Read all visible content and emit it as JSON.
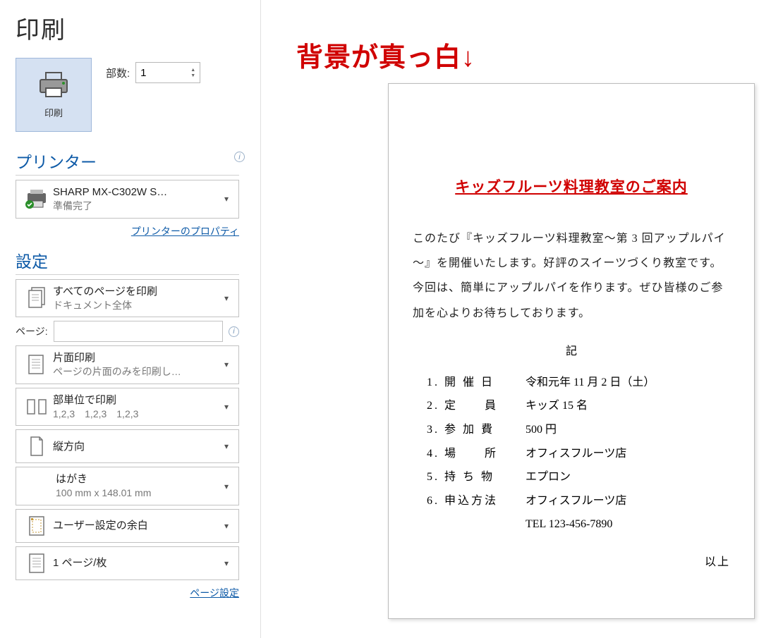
{
  "title": "印刷",
  "print_button_label": "印刷",
  "copies": {
    "label": "部数:",
    "value": "1"
  },
  "printer_section": {
    "heading": "プリンター",
    "name": "SHARP MX-C302W S…",
    "status": "準備完了",
    "properties_link": "プリンターのプロパティ"
  },
  "settings_section": {
    "heading": "設定",
    "print_range": {
      "line1": "すべてのページを印刷",
      "line2": "ドキュメント全体"
    },
    "pages_label": "ページ:",
    "duplex": {
      "line1": "片面印刷",
      "line2": "ページの片面のみを印刷し…"
    },
    "collation": {
      "line1": "部単位で印刷",
      "line2": "1,2,3　1,2,3　1,2,3"
    },
    "orientation": {
      "line1": "縦方向"
    },
    "paper": {
      "line1": "はがき",
      "line2": "100 mm x 148.01 mm"
    },
    "margins": {
      "line1": "ユーザー設定の余白"
    },
    "per_sheet": {
      "line1": "1 ページ/枚"
    },
    "page_setup_link": "ページ設定"
  },
  "annotation": "背景が真っ白↓",
  "document": {
    "title": "キッズフルーツ料理教室のご案内",
    "body": "このたび『キッズフルーツ料理教室～第 3 回アップルパイ～』を開催いたします。好評のスイーツづくり教室です。今回は、簡単にアップルパイを作ります。ぜひ皆様のご参加を心よりお待ちしております。",
    "ki": "記",
    "items": [
      {
        "num": "1.",
        "label": "開 催 日",
        "value": "令和元年 11 月 2 日（土）"
      },
      {
        "num": "2.",
        "label": "定　　員",
        "value": "キッズ 15 名"
      },
      {
        "num": "3.",
        "label": "参 加 費",
        "value": "500 円"
      },
      {
        "num": "4.",
        "label": "場　　所",
        "value": "オフィスフルーツ店"
      },
      {
        "num": "5.",
        "label": "持 ち 物",
        "value": "エプロン"
      },
      {
        "num": "6.",
        "label": "申込方法",
        "value": "オフィスフルーツ店"
      }
    ],
    "tel": "TEL 123-456-7890",
    "ijou": "以上"
  }
}
